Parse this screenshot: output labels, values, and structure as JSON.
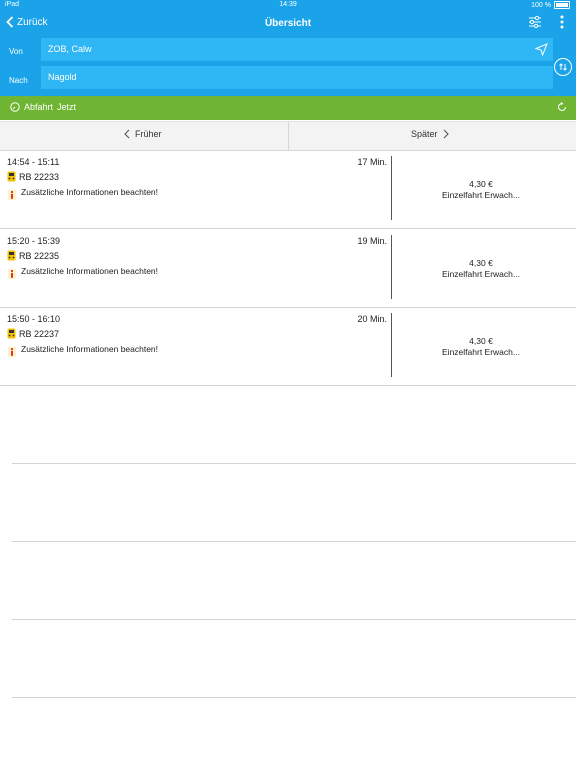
{
  "statusbar": {
    "device": "iPad",
    "time": "14:39",
    "battery": "100 %"
  },
  "navbar": {
    "back_label": "Zurück",
    "title": "Übersicht",
    "icons": [
      "chevron-left-icon",
      "filter-sliders-icon",
      "more-vertical-icon"
    ]
  },
  "search": {
    "from_label": "Von",
    "from_value": "ZOB, Calw",
    "to_label": "Nach",
    "to_value": "Nagold"
  },
  "departure": {
    "label": "Abfahrt",
    "value": "Jetzt"
  },
  "pager": {
    "earlier": "Früher",
    "later": "Später"
  },
  "connections": [
    {
      "time": "14:54 - 15:11",
      "duration": "17 Min.",
      "train": "RB 22233",
      "info": "Zusätzliche Informationen beachten!",
      "price": "4,30 €",
      "ticket": "Einzelfahrt Erwach..."
    },
    {
      "time": "15:20 - 15:39",
      "duration": "19 Min.",
      "train": "RB 22235",
      "info": "Zusätzliche Informationen beachten!",
      "price": "4,30 €",
      "ticket": "Einzelfahrt Erwach..."
    },
    {
      "time": "15:50 - 16:10",
      "duration": "20 Min.",
      "train": "RB 22237",
      "info": "Zusätzliche Informationen beachten!",
      "price": "4,30 €",
      "ticket": "Einzelfahrt Erwach..."
    }
  ],
  "colors": {
    "primary": "#1aa3e8",
    "field": "#2fb6f4",
    "green": "#6fb533",
    "info_red": "#d0021b",
    "train_yellow": "#f2c200"
  }
}
